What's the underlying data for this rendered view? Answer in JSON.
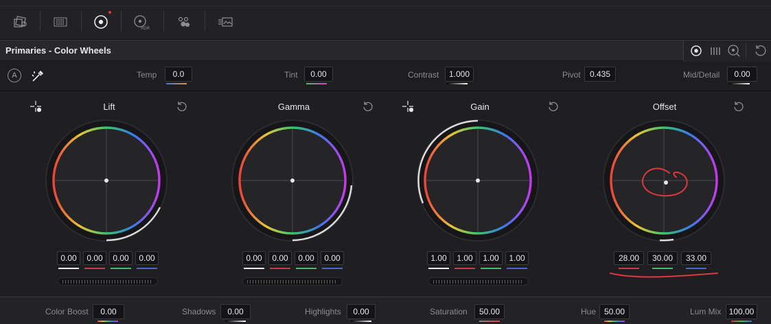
{
  "colors": {
    "accent_red": "#e0373f",
    "red": "#d03a3a",
    "green": "#3ec35a",
    "blue": "#3b6cd9",
    "white": "#eeeeee"
  },
  "toolbar": {
    "tools": [
      {
        "name": "camera-raw-icon"
      },
      {
        "name": "color-match-icon"
      },
      {
        "name": "primaries-wheels-icon",
        "active": true
      },
      {
        "name": "hdr-wheels-icon",
        "label": "HDR"
      },
      {
        "name": "rgb-mixer-icon"
      },
      {
        "name": "motion-effects-icon"
      }
    ]
  },
  "header": {
    "title": "Primaries - Color Wheels",
    "mode_icons": [
      "color-wheels-mode-icon",
      "primaries-bars-mode-icon",
      "log-wheels-mode-icon",
      "reset-all-icon"
    ]
  },
  "params": [
    {
      "label": "Temp",
      "value": "0.0"
    },
    {
      "label": "Tint",
      "value": "0.00"
    },
    {
      "label": "Contrast",
      "value": "1.000"
    },
    {
      "label": "Pivot",
      "value": "0.435"
    },
    {
      "label": "Mid/Detail",
      "value": "0.00"
    }
  ],
  "params_auto_label": "A",
  "wheels": [
    {
      "title": "Lift",
      "values": [
        "0.00",
        "0.00",
        "0.00",
        "0.00"
      ],
      "picker": true
    },
    {
      "title": "Gamma",
      "values": [
        "0.00",
        "0.00",
        "0.00",
        "0.00"
      ],
      "picker": false
    },
    {
      "title": "Gain",
      "values": [
        "1.00",
        "1.00",
        "1.00",
        "1.00"
      ],
      "picker": true
    },
    {
      "title": "Offset",
      "values": [
        "28.00",
        "30.00",
        "33.00"
      ],
      "picker": false
    }
  ],
  "bottom": [
    {
      "label": "Color Boost",
      "value": "0.00"
    },
    {
      "label": "Shadows",
      "value": "0.00"
    },
    {
      "label": "Highlights",
      "value": "0.00"
    },
    {
      "label": "Saturation",
      "value": "50.00"
    },
    {
      "label": "Hue",
      "value": "50.00"
    },
    {
      "label": "Lum Mix",
      "value": "100.00"
    }
  ]
}
